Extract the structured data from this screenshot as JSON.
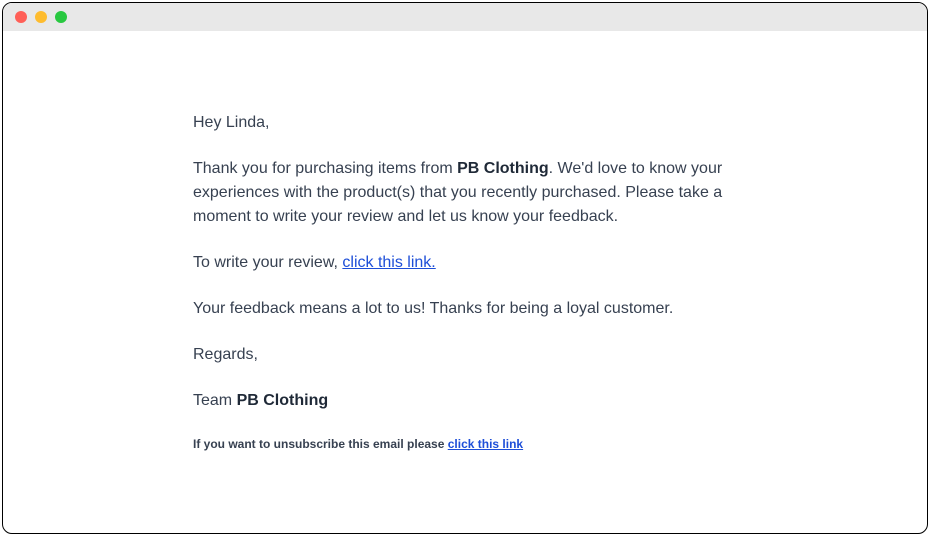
{
  "email": {
    "greeting": "Hey Linda,",
    "para1_pre": "Thank you for purchasing items from ",
    "para1_brand": "PB Clothing",
    "para1_post": ". We'd love to know your experiences with the product(s) that you recently purchased. Please take a moment to write your review and let us know your feedback.",
    "para2_pre": "To write your review, ",
    "para2_link": "click this link.",
    "para3": "Your feedback means a lot to us! Thanks for being a loyal customer.",
    "signoff": "Regards,",
    "team_pre": "Team ",
    "team_brand": "PB Clothing",
    "footer_pre": "If you want to unsubscribe this email please ",
    "footer_link": "click this link"
  }
}
